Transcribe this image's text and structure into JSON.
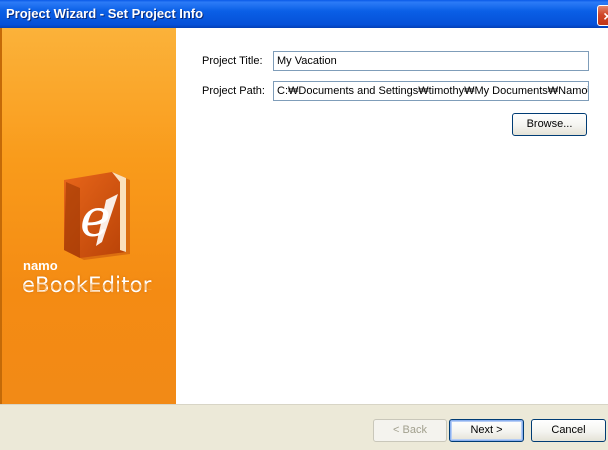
{
  "window": {
    "title": "Project Wizard - Set Project Info",
    "close_glyph": "×"
  },
  "sidebar": {
    "logo_icon": "ebook-e-logo",
    "brand_small": "namo",
    "brand_name": "eBookEditor",
    "accent_color": "#f99b1b"
  },
  "form": {
    "title_label": "Project Title:",
    "title_value": "My Vacation",
    "path_label": "Project Path:",
    "path_value": "C:₩Documents and Settings₩timothy₩My Documents₩Namo₩",
    "browse_label": "Browse..."
  },
  "footer": {
    "back_label": "< Back",
    "next_label": "Next >",
    "cancel_label": "Cancel"
  }
}
